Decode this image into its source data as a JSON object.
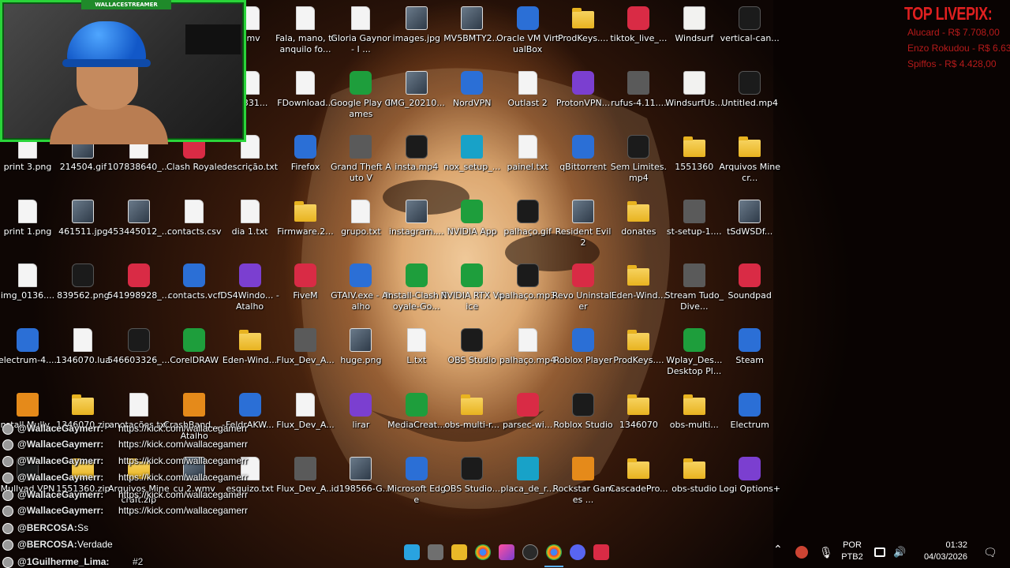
{
  "webcam": {
    "title": "WALLACESTREAMER"
  },
  "livepix": {
    "title": "TOP LIVEPIX:",
    "entries": [
      "Alucard - R$ 7.708,00",
      "Enzo Rokudou - R$ 6.63",
      "Spiffos - R$ 4.428,00"
    ]
  },
  "desktop": {
    "icons": [
      {
        "label": "wmv",
        "type": "file"
      },
      {
        "label": "Fala, mano, tranquilo fo...",
        "type": "file"
      },
      {
        "label": "Gloria Gaynor - I ...",
        "type": "file"
      },
      {
        "label": "images.jpg",
        "type": "img"
      },
      {
        "label": "MV5BMTY2...",
        "type": "img"
      },
      {
        "label": "Oracle VM VirtualBox",
        "type": "app-blue"
      },
      {
        "label": "ProdKeys....",
        "type": "folder"
      },
      {
        "label": "tiktok_live_...",
        "type": "app-red"
      },
      {
        "label": "Windsurf",
        "type": "ws"
      },
      {
        "label": "vertical-can...",
        "type": "app-dark"
      },
      {
        "label": "37331...",
        "type": "file"
      },
      {
        "label": "FDownload...",
        "type": "file"
      },
      {
        "label": "Google Play Games",
        "type": "app-green"
      },
      {
        "label": "IMG_20210...",
        "type": "img"
      },
      {
        "label": "NordVPN",
        "type": "app-blue"
      },
      {
        "label": "Outlast 2",
        "type": "file"
      },
      {
        "label": "ProtonVPN...",
        "type": "app-purple"
      },
      {
        "label": "rufus-4.11....",
        "type": "gray"
      },
      {
        "label": "WindsurfUs...",
        "type": "ws"
      },
      {
        "label": "Untitled.mp4",
        "type": "app-dark"
      },
      {
        "label": "print 3.png",
        "type": "file"
      },
      {
        "label": "214504.gif",
        "type": "img"
      },
      {
        "label": "107838640_...",
        "type": "file"
      },
      {
        "label": "Clash Royale",
        "type": "app-red"
      },
      {
        "label": "descrição.txt",
        "type": "file"
      },
      {
        "label": "Firefox",
        "type": "app-blue"
      },
      {
        "label": "Grand Theft Auto V",
        "type": "gray"
      },
      {
        "label": "insta.mp4",
        "type": "app-dark"
      },
      {
        "label": "nox_setup_...",
        "type": "cyan"
      },
      {
        "label": "painel.txt",
        "type": "file"
      },
      {
        "label": "qBittorrent",
        "type": "app-blue"
      },
      {
        "label": "Sem Limites.mp4",
        "type": "app-dark"
      },
      {
        "label": "1551360",
        "type": "folder"
      },
      {
        "label": "Arquivos Minecr...",
        "type": "folder"
      },
      {
        "label": "print 1.png",
        "type": "file"
      },
      {
        "label": "461511.jpg",
        "type": "img"
      },
      {
        "label": "453445012_...",
        "type": "img"
      },
      {
        "label": "contacts.csv",
        "type": "file"
      },
      {
        "label": "dia 1.txt",
        "type": "file"
      },
      {
        "label": "Firmware.2...",
        "type": "folder"
      },
      {
        "label": "grupo.txt",
        "type": "file"
      },
      {
        "label": "instagram....",
        "type": "img"
      },
      {
        "label": "NVIDIA App",
        "type": "app-green"
      },
      {
        "label": "palhaço.gif",
        "type": "app-dark"
      },
      {
        "label": "Resident Evil 2",
        "type": "img"
      },
      {
        "label": "donates",
        "type": "folder"
      },
      {
        "label": "st-setup-1....",
        "type": "gray"
      },
      {
        "label": "tSdWSDf...",
        "type": "img"
      },
      {
        "label": "img_0136....",
        "type": "file"
      },
      {
        "label": "839562.png",
        "type": "app-dark"
      },
      {
        "label": "541998928_...",
        "type": "app-red"
      },
      {
        "label": "contacts.vcf",
        "type": "app-blue"
      },
      {
        "label": "DS4Windo... - Atalho",
        "type": "app-purple"
      },
      {
        "label": "FiveM",
        "type": "app-red"
      },
      {
        "label": "GTAIV.exe - Atalho",
        "type": "app-blue"
      },
      {
        "label": "Install-Clash Royale-Go...",
        "type": "app-green"
      },
      {
        "label": "NVIDIA RTX Voice",
        "type": "app-green"
      },
      {
        "label": "palhaço.mp3",
        "type": "app-dark"
      },
      {
        "label": "Revo Uninstaller",
        "type": "app-red"
      },
      {
        "label": "Eden-Wind...",
        "type": "folder"
      },
      {
        "label": "Stream Tudo_Dive...",
        "type": "gray"
      },
      {
        "label": "Soundpad",
        "type": "app-red"
      },
      {
        "label": "electrum-4....",
        "type": "app-blue"
      },
      {
        "label": "1346070.lua",
        "type": "file"
      },
      {
        "label": "546603326_...",
        "type": "app-dark"
      },
      {
        "label": "CorelDRAW",
        "type": "app-green"
      },
      {
        "label": "Eden-Wind...",
        "type": "folder"
      },
      {
        "label": "Flux_Dev_A...",
        "type": "gray"
      },
      {
        "label": "huge.png",
        "type": "img"
      },
      {
        "label": "L.txt",
        "type": "file"
      },
      {
        "label": "OBS Studio",
        "type": "app-dark"
      },
      {
        "label": "palhaço.mp4",
        "type": "file"
      },
      {
        "label": "Roblox Player",
        "type": "app-blue"
      },
      {
        "label": "ProdKeys....",
        "type": "folder"
      },
      {
        "label": "Wplay_Des... Desktop Pl...",
        "type": "app-green"
      },
      {
        "label": "Steam",
        "type": "app-blue"
      },
      {
        "label": "Install Mullv...",
        "type": "orange"
      },
      {
        "label": "1346070.zip",
        "type": "folder"
      },
      {
        "label": "anotações.txt",
        "type": "file"
      },
      {
        "label": "CrashBand... - Atalho",
        "type": "orange"
      },
      {
        "label": "FeldrAKW...",
        "type": "app-blue"
      },
      {
        "label": "Flux_Dev_A...",
        "type": "file"
      },
      {
        "label": "lirar",
        "type": "app-purple"
      },
      {
        "label": "MediaCreat...",
        "type": "app-green"
      },
      {
        "label": "obs-multi-r...",
        "type": "folder"
      },
      {
        "label": "parsec-wi...",
        "type": "app-red"
      },
      {
        "label": "Roblox Studio",
        "type": "app-dark"
      },
      {
        "label": "1346070",
        "type": "folder"
      },
      {
        "label": "obs-multi...",
        "type": "folder"
      },
      {
        "label": "Electrum",
        "type": "app-blue"
      },
      {
        "label": "Mullvad VPN",
        "type": "app-dark"
      },
      {
        "label": "1551360.zip",
        "type": "folder"
      },
      {
        "label": "Arquivos Minecraft.zip",
        "type": "folder"
      },
      {
        "label": "cu 2.wmv",
        "type": "img"
      },
      {
        "label": "esquizo.txt",
        "type": "file"
      },
      {
        "label": "Flux_Dev_A...",
        "type": "gray"
      },
      {
        "label": "id198566-G...",
        "type": "img"
      },
      {
        "label": "Microsoft Edge",
        "type": "app-blue"
      },
      {
        "label": "OBS Studio...",
        "type": "app-dark"
      },
      {
        "label": "placa_de_r...",
        "type": "cyan"
      },
      {
        "label": "Rockstar Games ...",
        "type": "orange"
      },
      {
        "label": "CascadePro...",
        "type": "folder"
      },
      {
        "label": "obs-studio",
        "type": "folder"
      },
      {
        "label": "Logi Options+",
        "type": "app-purple"
      }
    ]
  },
  "chat": {
    "messages": [
      {
        "user": "@WallaceGaymerr:",
        "text": "https://kick.com/wallacegamerr"
      },
      {
        "user": "@WallaceGaymerr:",
        "text": "https://kick.com/wallacegamerr"
      },
      {
        "user": "@WallaceGaymerr:",
        "text": "https://kick.com/wallacegamerr"
      },
      {
        "user": "@WallaceGaymerr:",
        "text": "https://kick.com/wallacegamerr"
      },
      {
        "user": "@WallaceGaymerr:",
        "text": "https://kick.com/wallacegamerr"
      },
      {
        "user": "@WallaceGaymerr:",
        "text": "https://kick.com/wallacegamerr"
      },
      {
        "user": "@BERCOSA:",
        "text": "Ss"
      },
      {
        "user": "@BERCOSA:",
        "text": "Verdade"
      },
      {
        "user": "@1Guilherme_Lima:",
        "text": "#2"
      }
    ]
  },
  "taskbar": {
    "apps": [
      "file-explorer-icon",
      "window-icon",
      "folder-icon",
      "chrome-icon",
      "paint-icon",
      "obs-icon",
      "chrome-active-icon",
      "discord-icon",
      "app-red-icon"
    ]
  },
  "tray": {
    "lang1": "POR",
    "lang2": "PTB2",
    "time": "01:32",
    "date": "04/03/2026"
  },
  "colors": {
    "accent_green": "#2ad43a",
    "livepix_red": "#e02020"
  }
}
